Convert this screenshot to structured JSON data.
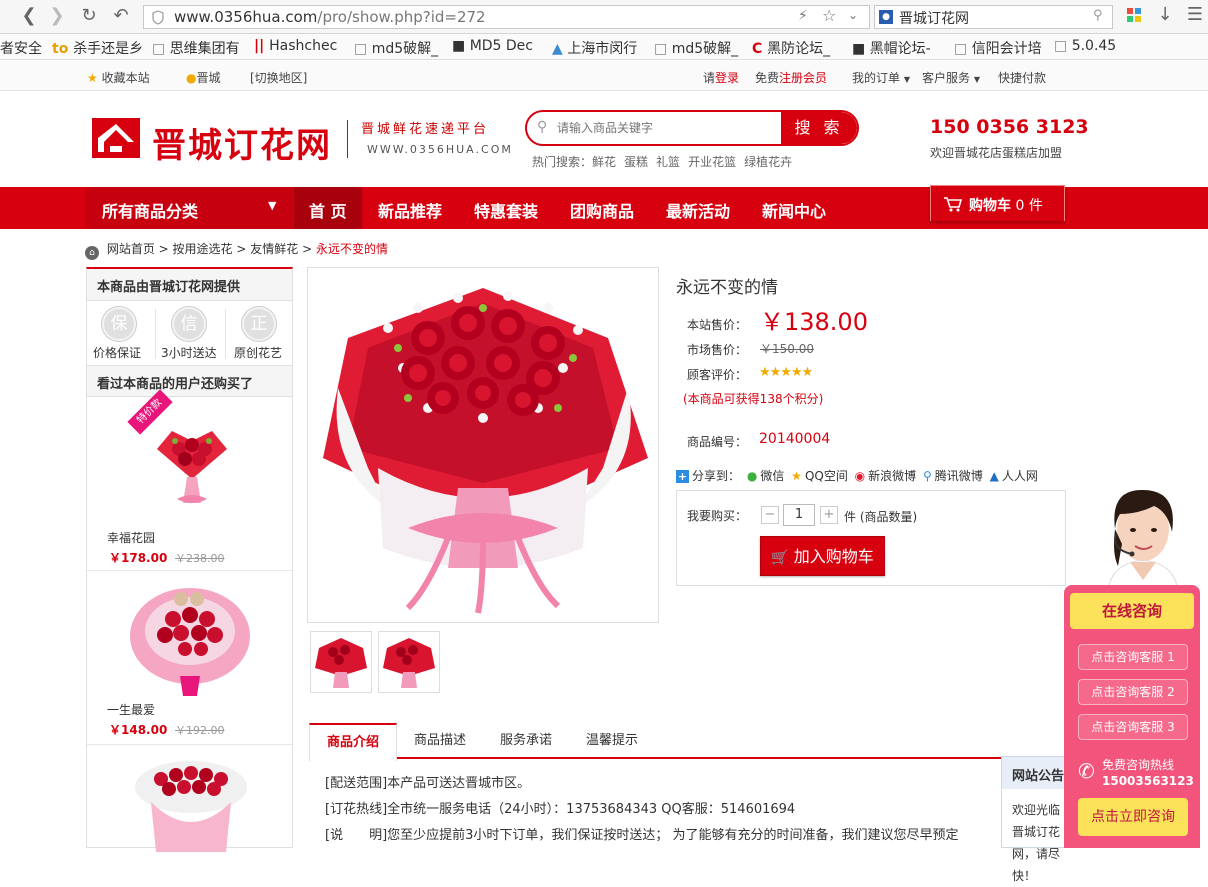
{
  "browser": {
    "url_host": "www.0356hua.com",
    "url_path": "/pro/show.php?id=272",
    "search_text": "晋城订花网",
    "bookmarks": [
      "者安全",
      "杀手还是乡",
      "思维集团有",
      "Hashchec",
      "md5破解_",
      "MD5 Dec",
      "上海市闵行",
      "md5破解_",
      "黑防论坛_",
      "黑帽论坛-",
      "信阳会计培",
      "5.0.45"
    ]
  },
  "topbar": {
    "favorite": "收藏本站",
    "city": "晋城",
    "switch_city": "[切换地区]",
    "login_prefix": "请",
    "login": "登录",
    "register_prefix": "免费",
    "register": "注册会员",
    "my_orders": "我的订单",
    "service": "客户服务",
    "quick_pay": "快捷付款"
  },
  "header": {
    "logo_text": "晋城订花网",
    "slogan": "晋城鲜花速递平台",
    "slogan_url": "WWW.0356HUA.COM",
    "search_placeholder": "请输入商品关键字",
    "search_button": "搜 索",
    "hot_label": "热门搜索：",
    "hot_words": [
      "鲜花",
      "蛋糕",
      "礼篮",
      "开业花篮",
      "绿植花卉"
    ],
    "phone": "150 0356 3123",
    "welcome": "欢迎晋城花店蛋糕店加盟"
  },
  "nav": {
    "all_categories": "所有商品分类",
    "items": [
      "首 页",
      "新品推荐",
      "特惠套装",
      "团购商品",
      "最新活动",
      "新闻中心"
    ],
    "cart_label": "购物车",
    "cart_count": "0",
    "cart_unit": "件"
  },
  "breadcrumb": [
    "网站首页",
    "按用途选花",
    "友情鲜花",
    "永远不变的情"
  ],
  "sidebar": {
    "provider_title": "本商品由晋城订花网提供",
    "badges": [
      {
        "icon": "保",
        "caption": "价格保证"
      },
      {
        "icon": "信",
        "caption": "3小时送达"
      },
      {
        "icon": "正",
        "caption": "原创花艺"
      }
    ],
    "also_bought_title": "看过本商品的用户还购买了",
    "special_tag": "特价款",
    "products": [
      {
        "name": "幸福花园",
        "price": "￥178.00",
        "old_price": "￥238.00"
      },
      {
        "name": "一生最爱",
        "price": "￥148.00",
        "old_price": "￥192.00"
      }
    ]
  },
  "product": {
    "title": "永远不变的情",
    "price_label": "本站售价：",
    "price": "￥138.00",
    "market_label": "市场售价：",
    "market_price": "￥150.00",
    "rating_label": "顾客评价：",
    "rating_stars": 5,
    "points_note": "(本商品可获得138个积分)",
    "sku_label": "商品编号：",
    "sku": "20140004",
    "share_label": "分享到：",
    "share_targets": [
      "微信",
      "QQ空间",
      "新浪微博",
      "腾讯微博",
      "人人网"
    ],
    "buy_label": "我要购买：",
    "quantity": "1",
    "qty_unit": "件 (商品数量)",
    "add_to_cart": "加入购物车"
  },
  "tabs": {
    "items": [
      "商品介绍",
      "商品描述",
      "服务承诺",
      "温馨提示"
    ],
    "active": 0
  },
  "description": [
    "[配送范围]本产品可送达晋城市区。",
    "[订花热线]全市统一服务电话（24小时）：13753684343 QQ客服：514601694",
    "[说　　明]您至少应提前3小时下订单，我们保证按时送达； 为了能够有充分的时间准备，我们建议您尽早预定"
  ],
  "support": {
    "title": "在线咨询",
    "buttons": [
      "点击咨询客服 1",
      "点击咨询客服 2",
      "点击咨询客服 3"
    ],
    "hotline_label": "免费咨询热线",
    "hotline": "15003563123",
    "consult_now": "点击立即咨询"
  },
  "notice": {
    "title": "网站公告",
    "body": "欢迎光临晋城订花网，请尽快！"
  },
  "colors": {
    "brand_red": "#d7000f",
    "consult_pink": "#f2547c",
    "consult_yellow": "#fbe25a"
  }
}
